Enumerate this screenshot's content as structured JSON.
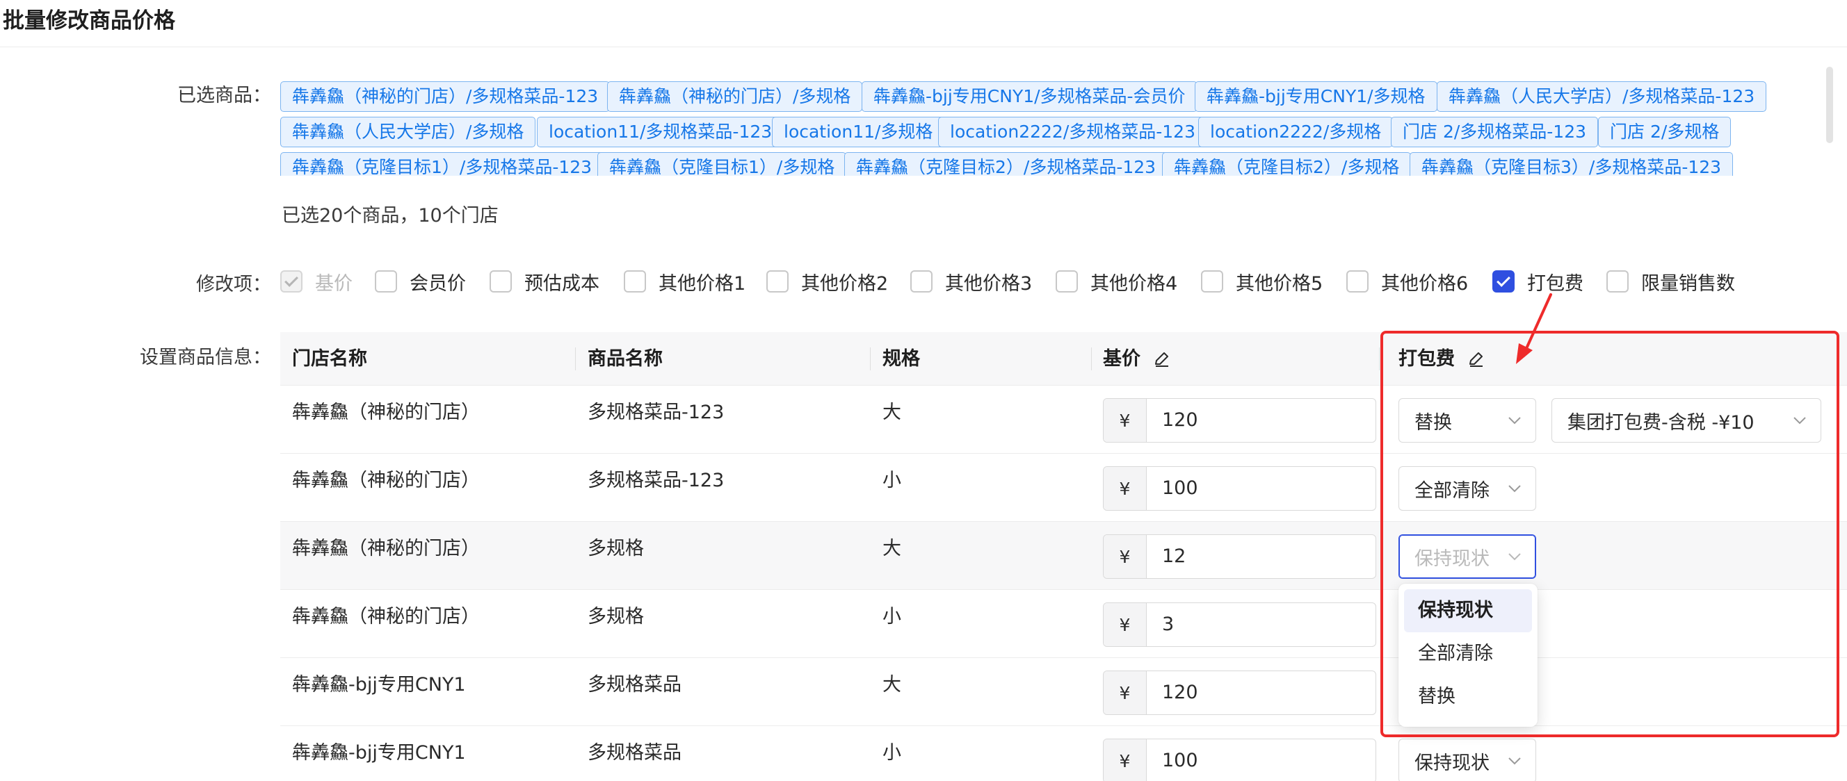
{
  "page": {
    "title": "批量修改商品价格"
  },
  "labels": {
    "selected_products": "已选商品：",
    "modify_items": "修改项：",
    "set_info": "设置商品信息："
  },
  "tags": [
    "犇羴鱻（神秘的门店）/多规格菜品-123",
    "犇羴鱻（神秘的门店）/多规格",
    "犇羴鱻-bjj专用CNY1/多规格菜品-会员价",
    "犇羴鱻-bjj专用CNY1/多规格",
    "犇羴鱻（人民大学店）/多规格菜品-123",
    "犇羴鱻（人民大学店）/多规格",
    "location11/多规格菜品-123",
    "location11/多规格",
    "location2222/多规格菜品-123",
    "location2222/多规格",
    "门店 2/多规格菜品-123",
    "门店 2/多规格",
    "犇羴鱻（克隆目标1）/多规格菜品-123",
    "犇羴鱻（克隆目标1）/多规格",
    "犇羴鱻（克隆目标2）/多规格菜品-123",
    "犇羴鱻（克隆目标2）/多规格",
    "犇羴鱻（克隆目标3）/多规格菜品-123"
  ],
  "summary": "已选20个商品，10个门店",
  "checkboxes": [
    {
      "label": "基价",
      "checked": true,
      "disabled": true
    },
    {
      "label": "会员价",
      "checked": false
    },
    {
      "label": "预估成本",
      "checked": false
    },
    {
      "label": "其他价格1",
      "checked": false
    },
    {
      "label": "其他价格2",
      "checked": false
    },
    {
      "label": "其他价格3",
      "checked": false
    },
    {
      "label": "其他价格4",
      "checked": false
    },
    {
      "label": "其他价格5",
      "checked": false
    },
    {
      "label": "其他价格6",
      "checked": false
    },
    {
      "label": "打包费",
      "checked": true
    },
    {
      "label": "限量销售数",
      "checked": false
    }
  ],
  "table": {
    "headers": {
      "store": "门店名称",
      "product": "商品名称",
      "spec": "规格",
      "base_price": "基价",
      "packaging_fee": "打包费"
    },
    "currency": "¥",
    "rows": [
      {
        "store": "犇羴鱻（神秘的门店）",
        "product": "多规格菜品-123",
        "spec": "大",
        "price": "120",
        "fee_mode": "替换",
        "fee_value": "集团打包费-含税 -¥10"
      },
      {
        "store": "犇羴鱻（神秘的门店）",
        "product": "多规格菜品-123",
        "spec": "小",
        "price": "100",
        "fee_mode": "全部清除"
      },
      {
        "store": "犇羴鱻（神秘的门店）",
        "product": "多规格",
        "spec": "大",
        "price": "12",
        "fee_placeholder": "保持现状"
      },
      {
        "store": "犇羴鱻（神秘的门店）",
        "product": "多规格",
        "spec": "小",
        "price": "3"
      },
      {
        "store": "犇羴鱻-bjj专用CNY1",
        "product": "多规格菜品",
        "spec": "大",
        "price": "120"
      },
      {
        "store": "犇羴鱻-bjj专用CNY1",
        "product": "多规格菜品",
        "spec": "小",
        "price": "100",
        "fee_mode": "保持现状"
      }
    ]
  },
  "dropdown": {
    "options": [
      "保持现状",
      "全部清除",
      "替换"
    ],
    "selected": "保持现状"
  },
  "colors": {
    "accent": "#2f4fe0",
    "tag_text": "#1677e8",
    "annotation": "#ee2b2b"
  }
}
